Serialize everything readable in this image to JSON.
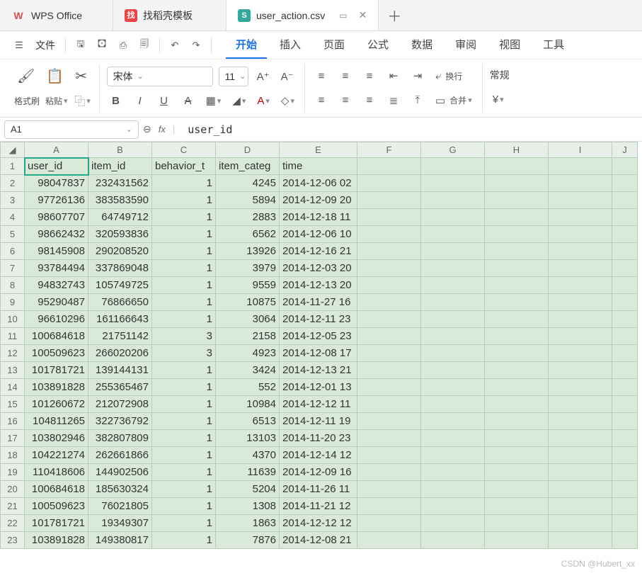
{
  "title_tabs": {
    "app": {
      "logo": "W",
      "label": "WPS Office"
    },
    "tab2": {
      "logo": "找",
      "label": "找稻壳模板"
    },
    "tab3": {
      "logo": "S",
      "label": "user_action.csv"
    },
    "close_glyph": "✕",
    "window_glyph": "▭",
    "plus_glyph": "＋"
  },
  "menu": {
    "file": "文件",
    "ribbon": [
      "开始",
      "插入",
      "页面",
      "公式",
      "数据",
      "审阅",
      "视图",
      "工具"
    ]
  },
  "toolbar": {
    "format_painter": "格式刷",
    "paste": "粘贴",
    "font_name": "宋体",
    "font_size": "11",
    "wrap_text": "换行",
    "merge": "合并",
    "number_fmt": "常规",
    "currency": "¥"
  },
  "name_box": {
    "value": "A1"
  },
  "formula": {
    "fx": "fx",
    "value": "user_id"
  },
  "columns": [
    "A",
    "B",
    "C",
    "D",
    "E",
    "F",
    "G",
    "H",
    "I",
    "J"
  ],
  "headers": [
    "user_id",
    "item_id",
    "behavior_type",
    "item_category",
    "time"
  ],
  "headers_display": [
    "user_id",
    "item_id",
    "behavior_t",
    "item_categ",
    "time"
  ],
  "rows": [
    [
      "98047837",
      "232431562",
      "1",
      "4245",
      "2014-12-06 02"
    ],
    [
      "97726136",
      "383583590",
      "1",
      "5894",
      "2014-12-09 20"
    ],
    [
      "98607707",
      "64749712",
      "1",
      "2883",
      "2014-12-18 11"
    ],
    [
      "98662432",
      "320593836",
      "1",
      "6562",
      "2014-12-06 10"
    ],
    [
      "98145908",
      "290208520",
      "1",
      "13926",
      "2014-12-16 21"
    ],
    [
      "93784494",
      "337869048",
      "1",
      "3979",
      "2014-12-03 20"
    ],
    [
      "94832743",
      "105749725",
      "1",
      "9559",
      "2014-12-13 20"
    ],
    [
      "95290487",
      "76866650",
      "1",
      "10875",
      "2014-11-27 16"
    ],
    [
      "96610296",
      "161166643",
      "1",
      "3064",
      "2014-12-11 23"
    ],
    [
      "100684618",
      "21751142",
      "3",
      "2158",
      "2014-12-05 23"
    ],
    [
      "100509623",
      "266020206",
      "3",
      "4923",
      "2014-12-08 17"
    ],
    [
      "101781721",
      "139144131",
      "1",
      "3424",
      "2014-12-13 21"
    ],
    [
      "103891828",
      "255365467",
      "1",
      "552",
      "2014-12-01 13"
    ],
    [
      "101260672",
      "212072908",
      "1",
      "10984",
      "2014-12-12 11"
    ],
    [
      "104811265",
      "322736792",
      "1",
      "6513",
      "2014-12-11 19"
    ],
    [
      "103802946",
      "382807809",
      "1",
      "13103",
      "2014-11-20 23"
    ],
    [
      "104221274",
      "262661866",
      "1",
      "4370",
      "2014-12-14 12"
    ],
    [
      "110418606",
      "144902506",
      "1",
      "11639",
      "2014-12-09 16"
    ],
    [
      "100684618",
      "185630324",
      "1",
      "5204",
      "2014-11-26 11"
    ],
    [
      "100509623",
      "76021805",
      "1",
      "1308",
      "2014-11-21 12"
    ],
    [
      "101781721",
      "19349307",
      "1",
      "1863",
      "2014-12-12 12"
    ],
    [
      "103891828",
      "149380817",
      "1",
      "7876",
      "2014-12-08 21"
    ]
  ],
  "watermark": "CSDN @Hubert_xx"
}
